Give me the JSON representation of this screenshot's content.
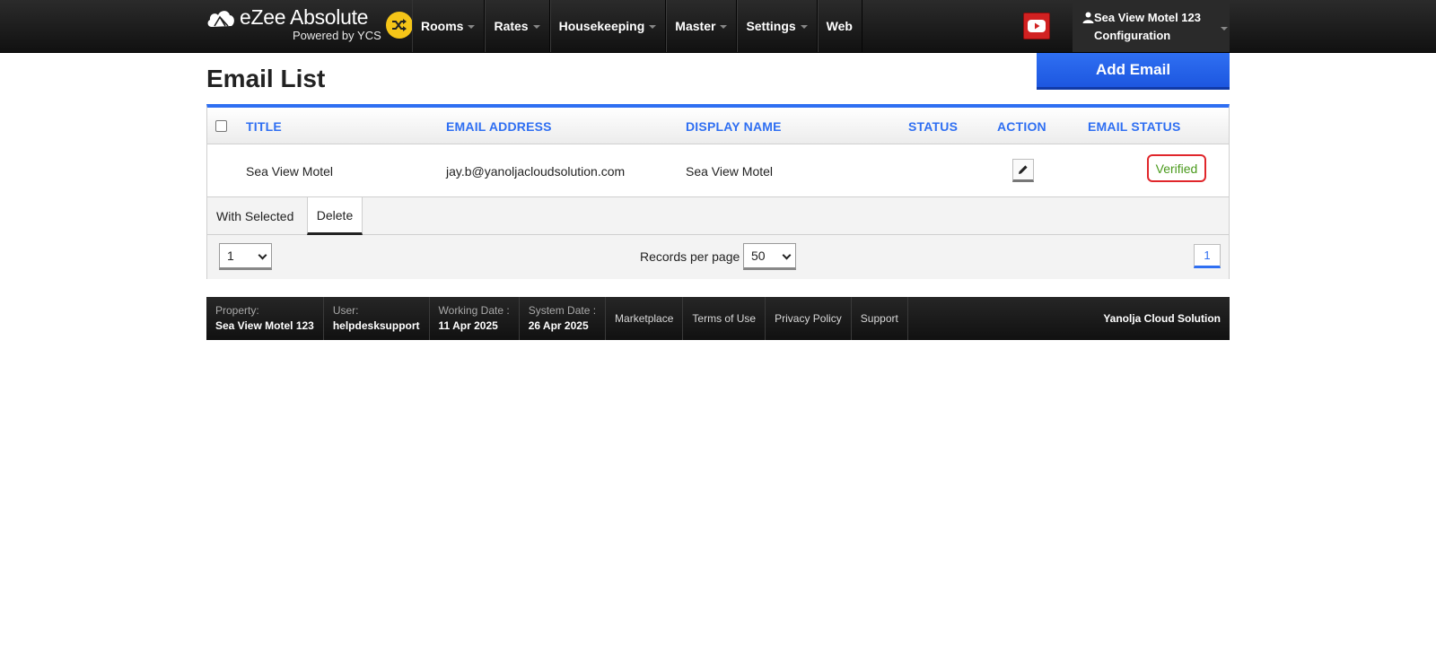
{
  "brand": {
    "name": "eZee Absolute",
    "sub": "Powered by YCS"
  },
  "nav": {
    "items": [
      {
        "label": "Rooms",
        "has_menu": true
      },
      {
        "label": "Rates",
        "has_menu": true
      },
      {
        "label": "Housekeeping",
        "has_menu": true
      },
      {
        "label": "Master",
        "has_menu": true
      },
      {
        "label": "Settings",
        "has_menu": true
      },
      {
        "label": "Web",
        "has_menu": false
      }
    ]
  },
  "user_menu": {
    "property": "Sea View Motel 123",
    "section": "Configuration"
  },
  "page": {
    "title": "Email List",
    "add_button": "Add Email"
  },
  "grid": {
    "columns": [
      "TITLE",
      "EMAIL ADDRESS",
      "DISPLAY NAME",
      "STATUS",
      "ACTION",
      "EMAIL STATUS"
    ],
    "rows": [
      {
        "title": "Sea View Motel",
        "email": "jay.b@yanoljacloudsolution.com",
        "display_name": "Sea View Motel",
        "status": "",
        "email_status": "Verified"
      }
    ],
    "bulk_label": "With Selected",
    "bulk_action": "Delete",
    "page_select": "1",
    "records_label": "Records per page",
    "records_per_page": "50",
    "current_page": "1"
  },
  "footer": {
    "property_label": "Property:",
    "property_value": "Sea View Motel 123",
    "user_label": "User:",
    "user_value": "helpdesksupport",
    "working_label": "Working Date :",
    "working_value": "11 Apr 2025",
    "system_label": "System Date :",
    "system_value": "26 Apr 2025",
    "links": [
      "Marketplace",
      "Terms of Use",
      "Privacy Policy",
      "Support"
    ],
    "company": "Yanolja Cloud Solution"
  },
  "colors": {
    "accent": "#2f6ff2",
    "verified_text": "#4a9a1c",
    "verified_border": "#e0262b",
    "switch": "#f5c518",
    "youtube": "#d12121"
  },
  "icons": [
    "ezee-cloud-logo-icon",
    "shuffle-icon",
    "youtube-icon",
    "user-icon",
    "pencil-icon",
    "chevron-down-icon"
  ]
}
